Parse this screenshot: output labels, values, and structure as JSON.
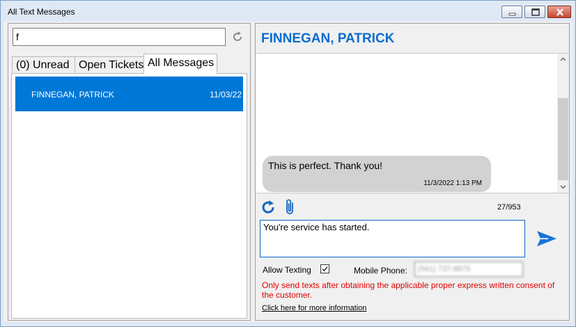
{
  "window": {
    "title": "All Text Messages"
  },
  "search": {
    "value": "f"
  },
  "tabs": [
    {
      "label": "(0) Unread"
    },
    {
      "label": "Open Tickets"
    },
    {
      "label": "All Messages"
    }
  ],
  "list": [
    {
      "name": "FINNEGAN, PATRICK",
      "date": "11/03/22"
    }
  ],
  "conversation": {
    "contact": "FINNEGAN, PATRICK",
    "messages": [
      {
        "text": "This is perfect. Thank you!",
        "time": "11/3/2022 1:13 PM"
      }
    ]
  },
  "compose": {
    "char_count": "27/953",
    "value": "You're service has started."
  },
  "options": {
    "allow_texting_label": "Allow Texting",
    "allow_texting_checked": true,
    "mobile_phone_label": "Mobile Phone:",
    "mobile_phone_value": "(561) 737-8875"
  },
  "warning": "Only send texts after obtaining the applicable proper express written consent of the customer.",
  "info_link": "Click here for more information",
  "colors": {
    "accent": "#0078d7",
    "contact_title": "#0a6ccf",
    "warning": "#e00000",
    "bubble": "#d2d2d2"
  }
}
